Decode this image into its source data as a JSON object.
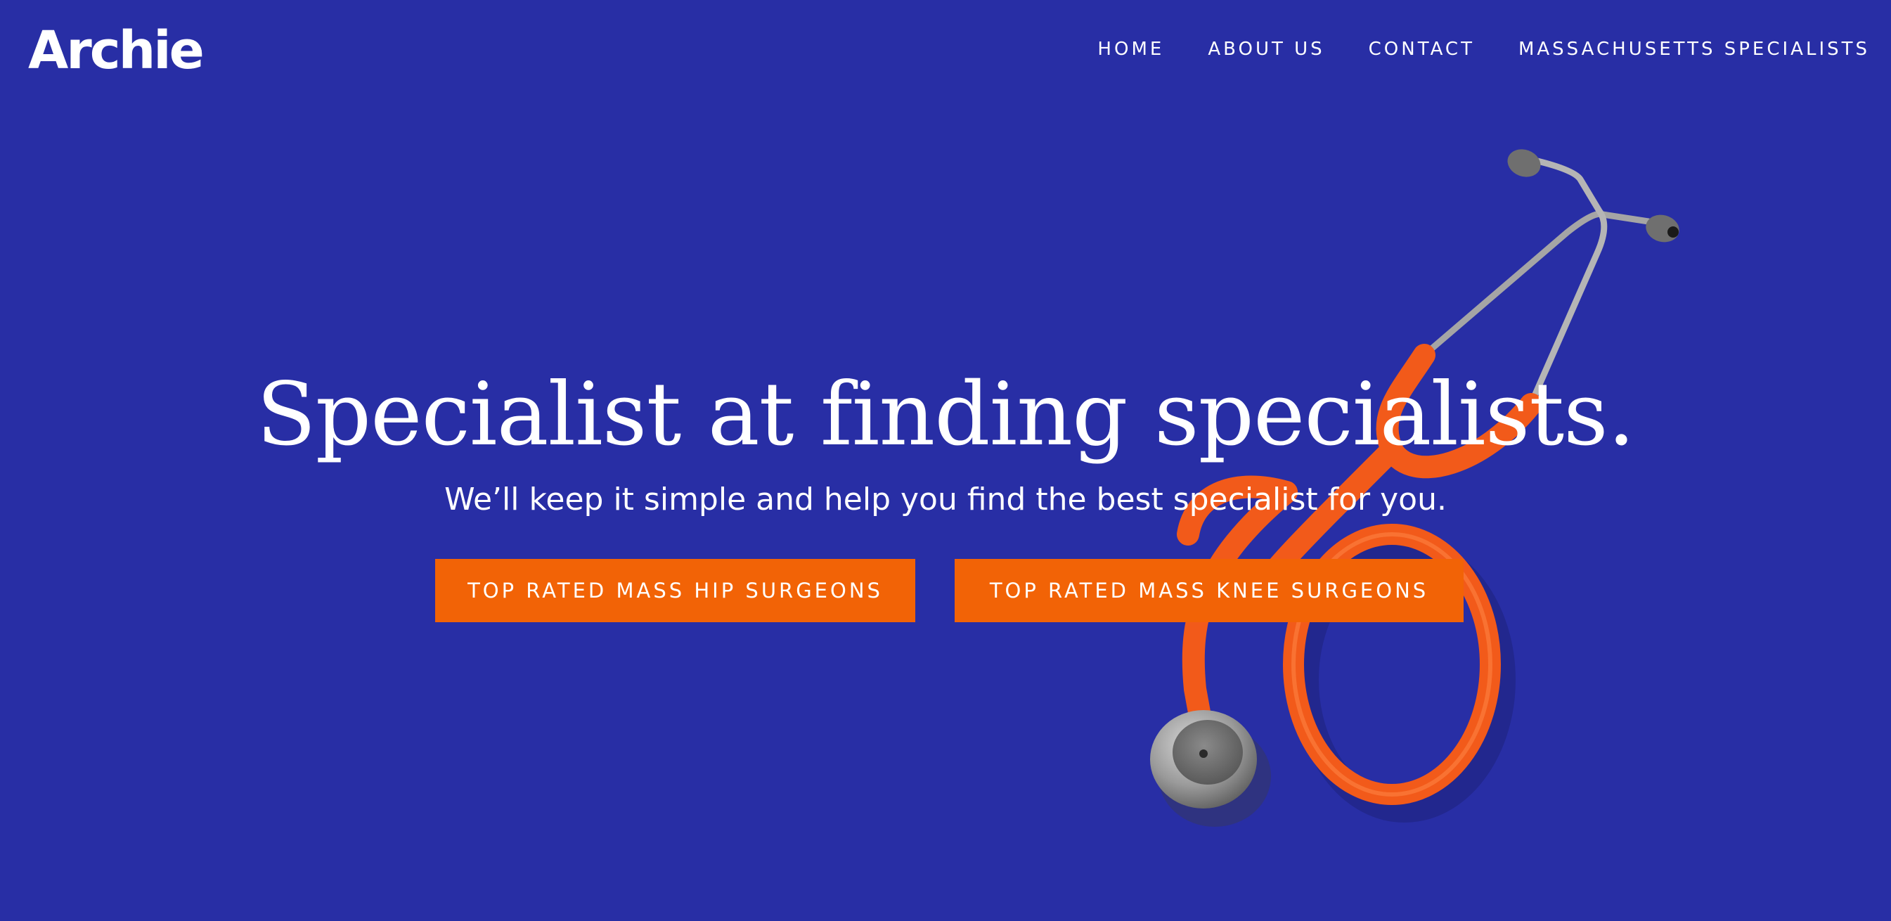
{
  "header": {
    "logo": "Archie",
    "nav": [
      {
        "label": "HOME"
      },
      {
        "label": "ABOUT US"
      },
      {
        "label": "CONTACT"
      },
      {
        "label": "MASSACHUSETTS SPECIALISTS"
      }
    ]
  },
  "hero": {
    "headline": "Specialist at finding specialists.",
    "subheadline": "We’ll keep it simple and help you find the best specialist for you.",
    "buttons": [
      {
        "label": "TOP RATED MASS HIP SURGEONS"
      },
      {
        "label": "TOP RATED MASS KNEE SURGEONS"
      }
    ],
    "image": "stethoscope-image"
  },
  "colors": {
    "background": "#282ea5",
    "accent": "#f26306",
    "text": "#ffffff"
  }
}
